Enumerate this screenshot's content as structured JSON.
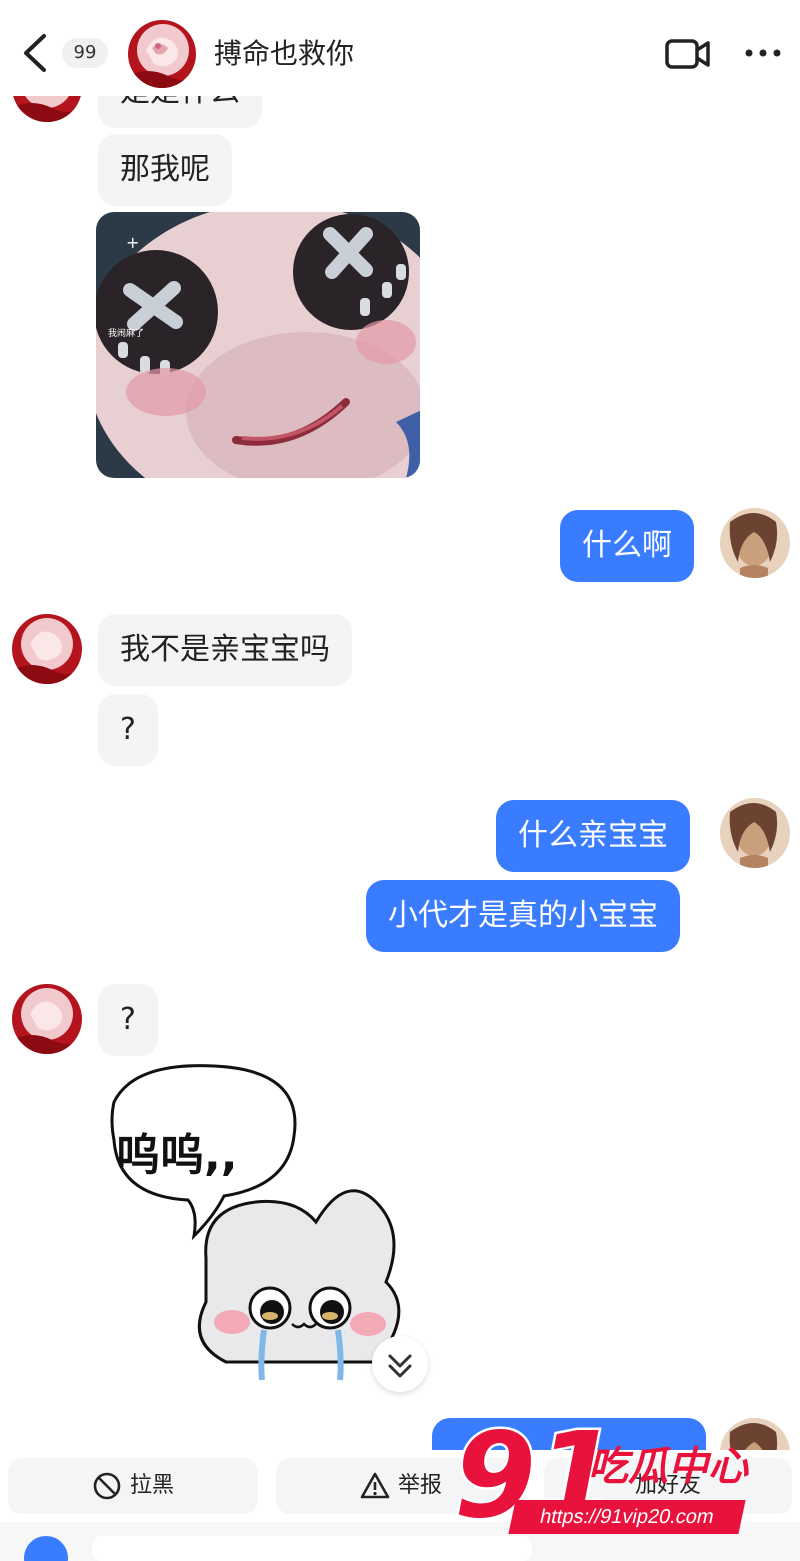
{
  "header": {
    "unread_count": "99",
    "contact_name": "搏命也救你",
    "icons": [
      "back-icon",
      "video-call-icon",
      "more-icon"
    ]
  },
  "messages": [
    {
      "side": "in",
      "text": "是是什么"
    },
    {
      "side": "in",
      "text": "那我呢"
    },
    {
      "side": "in",
      "type": "image",
      "image": "doll-face-sticker",
      "image_caption": "我闹麻了"
    },
    {
      "side": "out",
      "text": "什么啊"
    },
    {
      "side": "in",
      "text": "我不是亲宝宝吗"
    },
    {
      "side": "in",
      "text": "?"
    },
    {
      "side": "out",
      "text": "什么亲宝宝"
    },
    {
      "side": "out",
      "text": "小代才是真的小宝宝"
    },
    {
      "side": "in",
      "text": "?"
    },
    {
      "side": "in",
      "type": "image",
      "image": "crying-bunny-sticker",
      "image_caption": "呜呜,,"
    }
  ],
  "actions": {
    "block_label": "拉黑",
    "report_label": "举报",
    "third_label": "加好友"
  },
  "watermark": {
    "number": "91",
    "title": "吃瓜中心",
    "url": "https://91vip20.com"
  },
  "colors": {
    "outgoing_bubble": "#3a7cff",
    "incoming_bubble": "#f3f4f6",
    "watermark_red": "#e8123c"
  }
}
